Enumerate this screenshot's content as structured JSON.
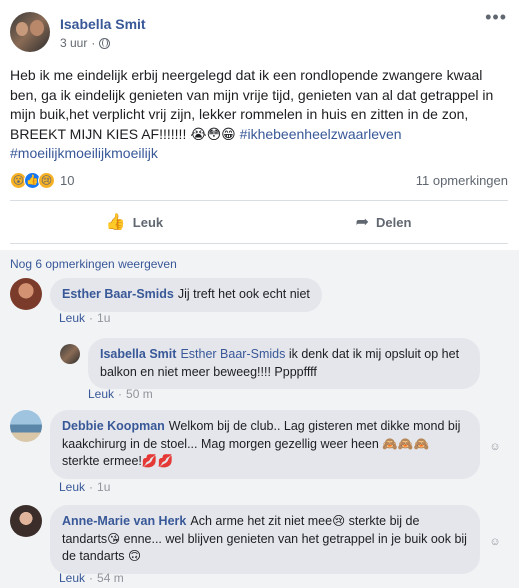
{
  "post": {
    "author": "Isabella Smit",
    "time": "3 uur",
    "dot": "·",
    "more_icon": "•••",
    "body": "Heb ik me eindelijk erbij neergelegd dat ik een rondlopende zwangere kwaal ben, ga ik eindelijk genieten van mijn vrije tijd, genieten van al dat getrappel in mijn buik,het verplicht vrij zijn, lekker rommelen in huis en zitten in de zon, BREEKT MIJN KIES AF!!!!!!! 😭😳😁",
    "hashtag1": "#ikhebeenheelzwaarleven",
    "hashtag2": "#moeilijkmoeilijkmoeilijk",
    "reaction_icons": [
      "😮",
      "👍",
      "😢"
    ],
    "reaction_count": "10",
    "comment_count": "11 opmerkingen",
    "like_label": "Leuk",
    "share_label": "Delen",
    "like_icon": "👍",
    "share_icon": "➦"
  },
  "comments_section": {
    "more_comments": "Nog 6 opmerkingen weergeven",
    "comments": [
      {
        "name": "Esther Baar-Smids",
        "text": "Jij treft het ook echt niet",
        "like": "Leuk",
        "sep": "·",
        "time": "1u"
      },
      {
        "name": "Isabella Smit",
        "mention": "Esther Baar-Smids",
        "text": "ik denk dat ik mij opsluit op het balkon en niet meer beweeg!!!! Ppppffff",
        "like": "Leuk",
        "sep": "·",
        "time": "50 m"
      },
      {
        "name": "Debbie Koopman",
        "text": "Welkom bij de club.. Lag gisteren met dikke mond bij kaakchirurg in de stoel... Mag morgen gezellig weer heen 🙈🙈🙈 sterkte ermee!💋💋",
        "like": "Leuk",
        "sep": "·",
        "time": "1u"
      },
      {
        "name": "Anne-Marie van Herk",
        "text": "Ach arme het zit niet mee😢 sterkte bij de tandarts😘 enne... wel blijven genieten van het getrappel in je buik ook bij de tandarts 🙃",
        "like": "Leuk",
        "sep": "·",
        "time": "54 m"
      }
    ]
  }
}
